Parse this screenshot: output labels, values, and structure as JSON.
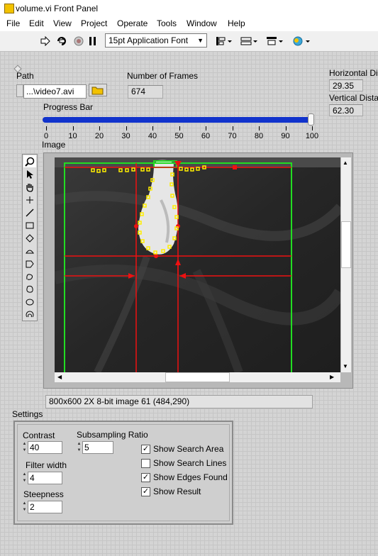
{
  "window": {
    "title": "volume.vi Front Panel"
  },
  "menu": [
    "File",
    "Edit",
    "View",
    "Project",
    "Operate",
    "Tools",
    "Window",
    "Help"
  ],
  "toolbar": {
    "font": "15pt Application Font"
  },
  "path": {
    "label": "Path",
    "value": "...\\video7.avi"
  },
  "frames": {
    "label": "Number of Frames",
    "value": "674"
  },
  "horizontal": {
    "label": "Horizontal Dist",
    "value": "29.35"
  },
  "vertical": {
    "label": "Vertical Distan",
    "value": "62.30"
  },
  "progress": {
    "label": "Progress Bar",
    "value": 100,
    "ticks": [
      "0",
      "10",
      "20",
      "30",
      "40",
      "50",
      "60",
      "70",
      "80",
      "90",
      "100"
    ]
  },
  "image": {
    "label": "Image",
    "status": "800x600 2X 8-bit image 61     (484,290)"
  },
  "settings": {
    "label": "Settings",
    "contrast": {
      "label": "Contrast",
      "value": "40"
    },
    "filter_width": {
      "label": "Filter width",
      "value": "4"
    },
    "steepness": {
      "label": "Steepness",
      "value": "2"
    },
    "subsampling": {
      "label": "Subsampling Ratio",
      "value": "5"
    },
    "checkboxes": [
      {
        "label": "Show Search Area",
        "checked": true
      },
      {
        "label": "Show Search Lines",
        "checked": false
      },
      {
        "label": "Show Edges Found",
        "checked": true
      },
      {
        "label": "Show Result",
        "checked": true
      }
    ]
  },
  "icons": [
    "run-arrow-icon",
    "run-continuous-icon",
    "abort-icon",
    "pause-icon",
    "align-icon",
    "distribute-icon",
    "resize-icon",
    "reorder-icon",
    "zoom-icon",
    "pointer-icon",
    "pan-icon",
    "point-icon",
    "line-icon",
    "rectangle-icon",
    "oval-icon",
    "polygon-icon",
    "freehand-icon",
    "annulus-icon",
    "folder-icon"
  ],
  "colors": {
    "progress_fill": "#1133cc",
    "search_area": "#22dd22",
    "search_lines": "#ee1111",
    "edges": "#ffee00"
  }
}
